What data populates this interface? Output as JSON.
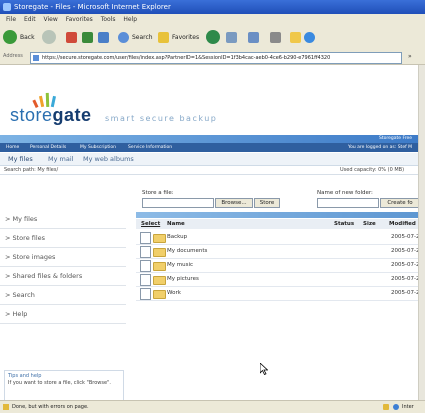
{
  "window": {
    "title": "Storegate - Files - Microsoft Internet Explorer"
  },
  "menubar": {
    "items": [
      "File",
      "Edit",
      "View",
      "Favorites",
      "Tools",
      "Help"
    ]
  },
  "toolbar": {
    "back_label": "Back",
    "search_label": "Search",
    "favorites_label": "Favorites"
  },
  "addressbar": {
    "label": "Address",
    "url": "https://secure.storegate.com/user/files/index.asp?PartnerID=1&SessionID=1f3b4cac-aeb0-4ce6-b290-e7961ff4320",
    "go_label": "»"
  },
  "site": {
    "logo_brand_part1": "store",
    "logo_brand_part2": "gate",
    "tagline": "smart secure backup",
    "top_right": "Storegate Free",
    "nav_items": [
      "Home",
      "Personal Details",
      "My Subscription",
      "Service Information"
    ],
    "logged_in_text": "You are logged on as: Stef M",
    "tabs": [
      "My files",
      "My mail",
      "My web albums"
    ],
    "search_path": "Search path: My files/",
    "capacity": "Used capacity: 0% (0 MB)"
  },
  "sidebar": {
    "items": [
      {
        "label": "> My files"
      },
      {
        "label": "> Store files"
      },
      {
        "label": "> Store images"
      },
      {
        "label": "> Shared files & folders"
      },
      {
        "label": "> Search"
      },
      {
        "label": "> Help"
      }
    ],
    "tips": {
      "title": "Tips and help",
      "text": "If you want to store a file, click \"Browse\"."
    }
  },
  "main": {
    "store_file_label": "Store a file:",
    "browse_label": "Browse...",
    "store_button": "Store",
    "new_folder_label": "Name of new folder:",
    "create_button": "Create fo",
    "columns": {
      "select": "Select",
      "name": "Name",
      "status": "Status",
      "size": "Size",
      "modified": "Modified"
    },
    "rows": [
      {
        "name": "Backup",
        "modified": "2005-07-2"
      },
      {
        "name": "My documents",
        "modified": "2005-07-2"
      },
      {
        "name": "My music",
        "modified": "2005-07-2"
      },
      {
        "name": "My pictures",
        "modified": "2005-07-2"
      },
      {
        "name": "Work",
        "modified": "2005-07-2"
      }
    ]
  },
  "statusbar": {
    "text": "Done, but with errors on page.",
    "zone": "Inter"
  },
  "colors": {
    "brand_blue": "#2a6fb0",
    "nav_dark": "#2f5f9f",
    "titlebar": "#1f4fb8",
    "folder_yellow": "#f1cf6a"
  },
  "icons": [
    "ie-icon",
    "back-icon",
    "forward-icon",
    "stop-icon",
    "refresh-icon",
    "home-icon",
    "search-icon",
    "favorites-icon",
    "media-icon",
    "history-icon",
    "mail-icon",
    "print-icon",
    "edit-icon",
    "messenger-icon",
    "folder-icon",
    "mouse-cursor-icon",
    "warning-icon",
    "lock-icon",
    "globe-icon"
  ]
}
